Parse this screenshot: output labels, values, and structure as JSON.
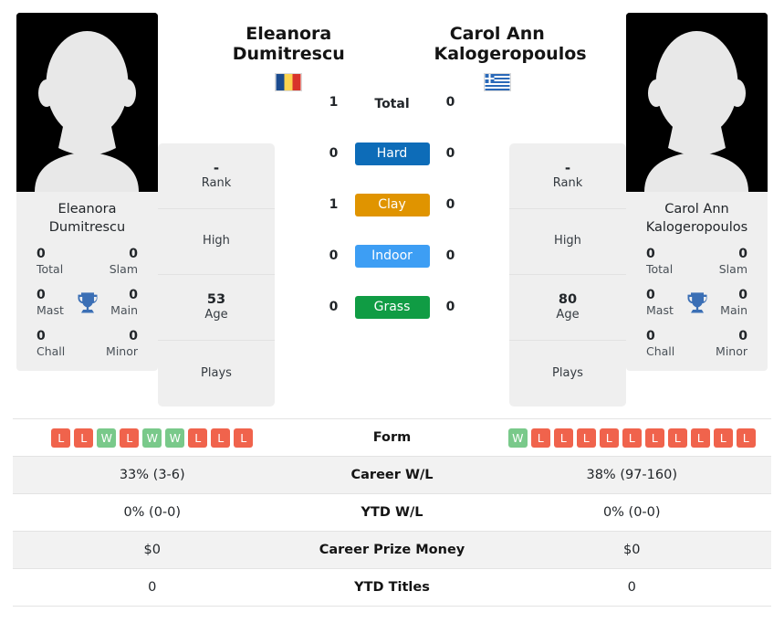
{
  "players": {
    "left": {
      "name_header": "Eleanora Dumitrescu",
      "name_line1": "Eleanora",
      "name_line2": "Dumitrescu",
      "card_name_line1": "Eleanora",
      "card_name_line2": "Dumitrescu",
      "country": "Romania",
      "flag_icon": "romania-flag-icon",
      "avatar_icon": "player-avatar-silhouette",
      "titles": {
        "total_value": "0",
        "total_label": "Total",
        "slam_value": "0",
        "slam_label": "Slam",
        "mast_value": "0",
        "mast_label": "Mast",
        "main_value": "0",
        "main_label": "Main",
        "chall_value": "0",
        "chall_label": "Chall",
        "minor_value": "0",
        "minor_label": "Minor",
        "trophy_icon": "trophy-icon"
      },
      "info": [
        {
          "value": "-",
          "label": "Rank"
        },
        {
          "value": "",
          "label": "High"
        },
        {
          "value": "53",
          "label": "Age"
        },
        {
          "value": "",
          "label": "Plays"
        }
      ],
      "form": [
        "L",
        "L",
        "W",
        "L",
        "W",
        "W",
        "L",
        "L",
        "L"
      ],
      "career_wl": "33% (3-6)",
      "ytd_wl": "0% (0-0)",
      "career_prize_money": "$0",
      "ytd_titles": "0"
    },
    "right": {
      "name_header": "Carol Ann Kalogeropoulos",
      "name_line1": "Carol Ann",
      "name_line2": "Kalogeropoulos",
      "card_name_line1": "Carol Ann",
      "card_name_line2": "Kalogeropoulos",
      "country": "Greece",
      "flag_icon": "greece-flag-icon",
      "avatar_icon": "player-avatar-silhouette",
      "titles": {
        "total_value": "0",
        "total_label": "Total",
        "slam_value": "0",
        "slam_label": "Slam",
        "mast_value": "0",
        "mast_label": "Mast",
        "main_value": "0",
        "main_label": "Main",
        "chall_value": "0",
        "chall_label": "Chall",
        "minor_value": "0",
        "minor_label": "Minor",
        "trophy_icon": "trophy-icon"
      },
      "info": [
        {
          "value": "-",
          "label": "Rank"
        },
        {
          "value": "",
          "label": "High"
        },
        {
          "value": "80",
          "label": "Age"
        },
        {
          "value": "",
          "label": "Plays"
        }
      ],
      "form": [
        "W",
        "L",
        "L",
        "L",
        "L",
        "L",
        "L",
        "L",
        "L",
        "L",
        "L"
      ],
      "career_wl": "38% (97-160)",
      "ytd_wl": "0% (0-0)",
      "career_prize_money": "$0",
      "ytd_titles": "0"
    }
  },
  "head_to_head": [
    {
      "label": "Total",
      "left": "1",
      "right": "0",
      "badge": false,
      "color": ""
    },
    {
      "label": "Hard",
      "left": "0",
      "right": "0",
      "badge": true,
      "color": "#0d6cb8"
    },
    {
      "label": "Clay",
      "left": "1",
      "right": "0",
      "badge": true,
      "color": "#e09400"
    },
    {
      "label": "Indoor",
      "left": "0",
      "right": "0",
      "badge": true,
      "color": "#3d9ef4"
    },
    {
      "label": "Grass",
      "left": "0",
      "right": "0",
      "badge": true,
      "color": "#109c44"
    }
  ],
  "comparison_rows": [
    {
      "label": "Form",
      "left": "",
      "right": "",
      "type": "form"
    },
    {
      "label": "Career W/L",
      "left": "33% (3-6)",
      "right": "38% (97-160)",
      "type": "text"
    },
    {
      "label": "YTD W/L",
      "left": "0% (0-0)",
      "right": "0% (0-0)",
      "type": "text"
    },
    {
      "label": "Career Prize Money",
      "left": "$0",
      "right": "$0",
      "type": "text"
    },
    {
      "label": "YTD Titles",
      "left": "0",
      "right": "0",
      "type": "text"
    }
  ],
  "colors": {
    "hard": "#0d6cb8",
    "clay": "#e09400",
    "indoor": "#3d9ef4",
    "grass": "#109c44",
    "win": "#79c98a",
    "loss": "#f0634c",
    "card_bg": "#efefef",
    "trophy": "#3b6fb5"
  }
}
